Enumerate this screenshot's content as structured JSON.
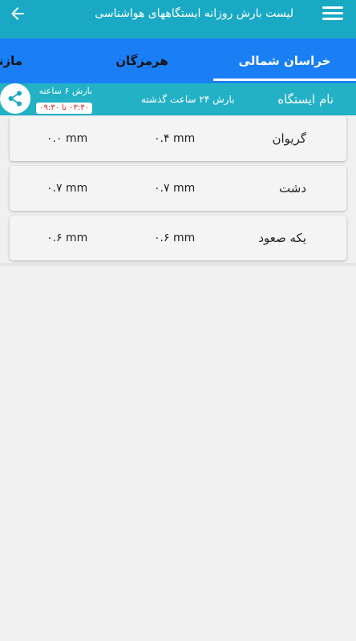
{
  "header": {
    "title": "لیست بارش روزانه ایستگاههای هواشناسی",
    "menu_icon": "menu-icon",
    "back_icon": "arrow-left-icon",
    "bar_color": "#1aa9c5"
  },
  "tabs": [
    {
      "label": "خراسان شمالی",
      "active": true
    },
    {
      "label": "هرمزگان",
      "active": false
    },
    {
      "label": "مازند",
      "active": false
    }
  ],
  "tabs_color": "#1a7ff6",
  "columns": {
    "station": "نام ایستگاه",
    "rain_24h": "بارش ۲۴ ساعت گذشته",
    "rain_6h": "بارش ۶ ساعته",
    "time_range": "۰۳:۳۰ تا ۰۹:۳۰"
  },
  "share_icon": "share-icon",
  "rows": [
    {
      "station": "گریوان",
      "rain_24h": "۰.۴ mm",
      "rain_6h": "۰.۰ mm"
    },
    {
      "station": "دشت",
      "rain_24h": "۰.۷ mm",
      "rain_6h": "۰.۷ mm"
    },
    {
      "station": "یکه صعود",
      "rain_24h": "۰.۶ mm",
      "rain_6h": "۰.۶ mm"
    }
  ]
}
